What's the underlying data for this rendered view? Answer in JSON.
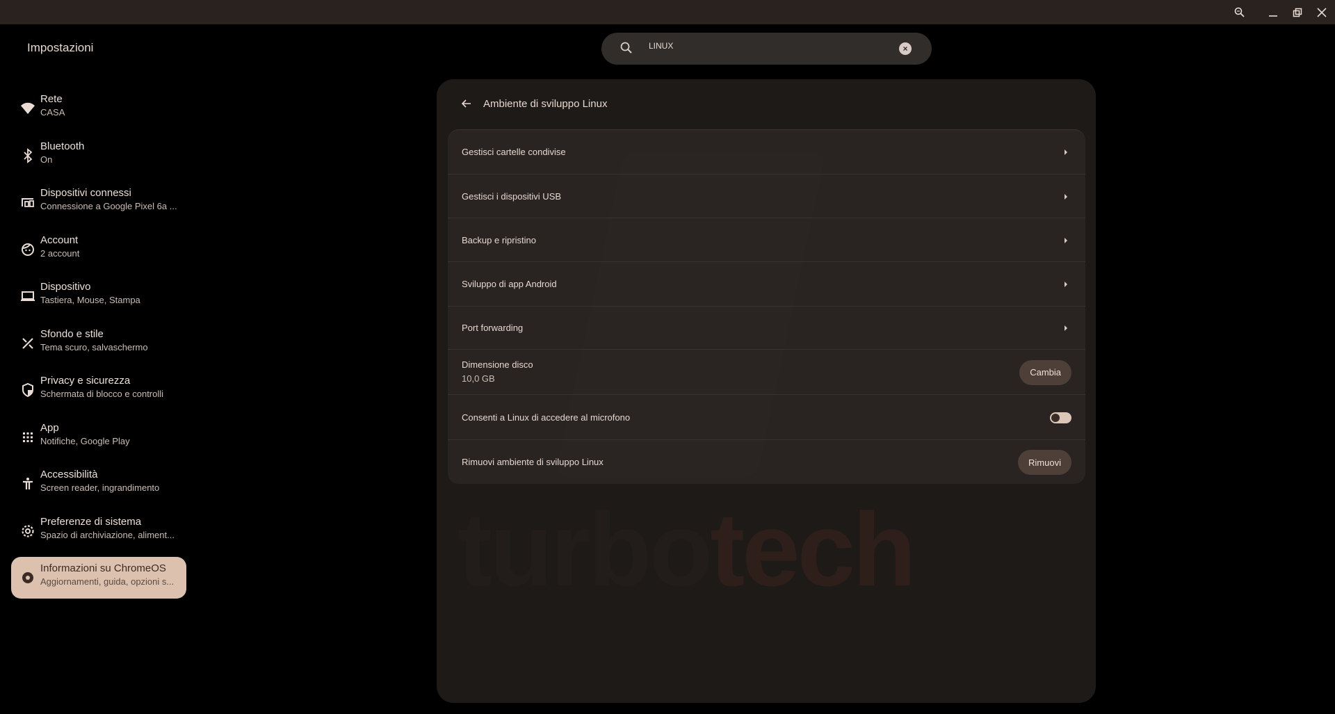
{
  "app_title": "Impostazioni",
  "search": {
    "value": "LINUX"
  },
  "sidebar": {
    "items": [
      {
        "label": "Rete",
        "sub": "CASA",
        "icon": "wifi-icon"
      },
      {
        "label": "Bluetooth",
        "sub": "On",
        "icon": "bluetooth-icon"
      },
      {
        "label": "Dispositivi connessi",
        "sub": "Connessione a Google Pixel 6a ...",
        "icon": "connected-devices-icon"
      },
      {
        "label": "Account",
        "sub": "2 account",
        "icon": "account-icon"
      },
      {
        "label": "Dispositivo",
        "sub": "Tastiera, Mouse, Stampa",
        "icon": "laptop-icon"
      },
      {
        "label": "Sfondo e stile",
        "sub": "Tema scuro, salvaschermo",
        "icon": "palette-icon"
      },
      {
        "label": "Privacy e sicurezza",
        "sub": "Schermata di blocco e controlli",
        "icon": "shield-icon"
      },
      {
        "label": "App",
        "sub": "Notifiche, Google Play",
        "icon": "apps-grid-icon"
      },
      {
        "label": "Accessibilità",
        "sub": "Screen reader, ingrandimento",
        "icon": "accessibility-icon"
      },
      {
        "label": "Preferenze di sistema",
        "sub": "Spazio di archiviazione, aliment...",
        "icon": "gear-icon"
      },
      {
        "label": "Informazioni su ChromeOS",
        "sub": "Aggiornamenti, guida, opzioni s...",
        "icon": "chrome-icon",
        "selected": true
      }
    ]
  },
  "main": {
    "title": "Ambiente di sviluppo Linux",
    "rows": [
      {
        "label": "Gestisci cartelle condivise"
      },
      {
        "label": "Gestisci i dispositivi USB"
      },
      {
        "label": "Backup e ripristino"
      },
      {
        "label": "Sviluppo di app Android"
      },
      {
        "label": "Port forwarding"
      },
      {
        "label": "Dimensione disco",
        "sub": "10,0 GB",
        "button": "Cambia"
      },
      {
        "label": "Consenti a Linux di accedere al microfono",
        "toggle": false
      },
      {
        "label": "Rimuovi ambiente di sviluppo Linux",
        "button": "Rimuovi"
      }
    ]
  },
  "watermark": {
    "text_a": "turbo",
    "text_b": "tech"
  },
  "colors": {
    "accent": "#dcc1ae",
    "button": "#4e4038",
    "panel": "#1e1a18",
    "titlebar": "#2a221e"
  }
}
